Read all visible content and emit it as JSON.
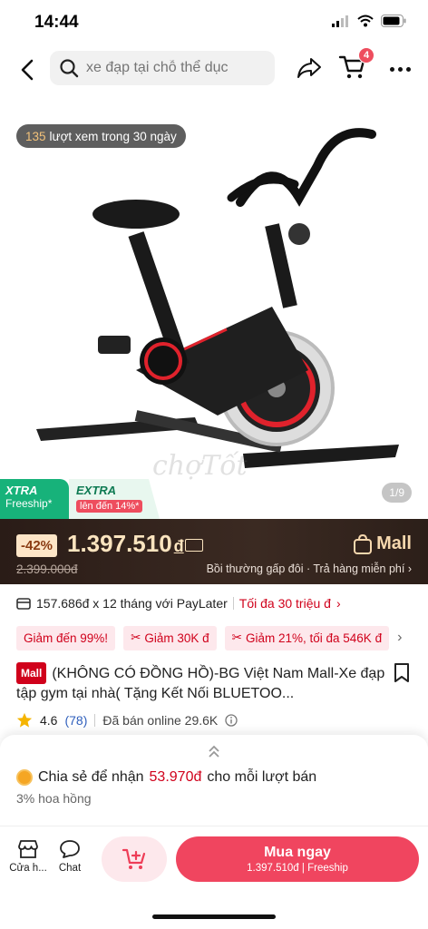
{
  "status_bar": {
    "time": "14:44"
  },
  "search": {
    "placeholder": "xe đạp tại chỗ thể dục"
  },
  "cart": {
    "badge_count": "4"
  },
  "hero": {
    "views_count": "135",
    "views_text": "lượt xem trong 30 ngày",
    "watermark": "chợTốt",
    "page_indicator": "1/9",
    "xtra_line1": "XTRA",
    "xtra_line2": "Freeship*",
    "extra_line1": "EXTRA",
    "extra_line2": "lên đến 14%*"
  },
  "price": {
    "discount": "-42%",
    "current": "1.397.510",
    "currency": "đ",
    "original": "2.399.000đ",
    "mall_label": "Mall",
    "guarantee": "Bồi thường gấp đôi · Trả hàng miễn phí"
  },
  "paylater": {
    "text": "157.686đ x 12 tháng với PayLater",
    "limit": "Tối đa 30 triệu đ"
  },
  "chips": [
    {
      "label": "Giảm đến 99%!"
    },
    {
      "label": "Giảm 30K đ"
    },
    {
      "label": "Giảm 21%, tối đa 546K đ"
    }
  ],
  "product": {
    "mall_badge": "Mall",
    "title": "(KHÔNG CÓ ĐỒNG HỒ)-BG Việt Nam Mall-Xe đạp tập gym tại nhà( Tặng Kết Nối BLUETOO...",
    "rating": "4.6",
    "rating_count": "(78)",
    "sold": "Đã bán online 29.6K"
  },
  "share": {
    "prefix": "Chia sẻ để nhận",
    "amount": "53.970đ",
    "suffix": "cho mỗi lượt bán",
    "commission": "3% hoa hồng"
  },
  "bottom": {
    "shop_label": "Cửa h...",
    "chat_label": "Chat",
    "buy_label": "Mua ngay",
    "buy_price": "1.397.510đ",
    "buy_ship": "Freeship"
  },
  "colors": {
    "accent": "#f0455f",
    "price_bar": "#2f211b",
    "xtra_green": "#17b27a",
    "red": "#d0011b"
  }
}
